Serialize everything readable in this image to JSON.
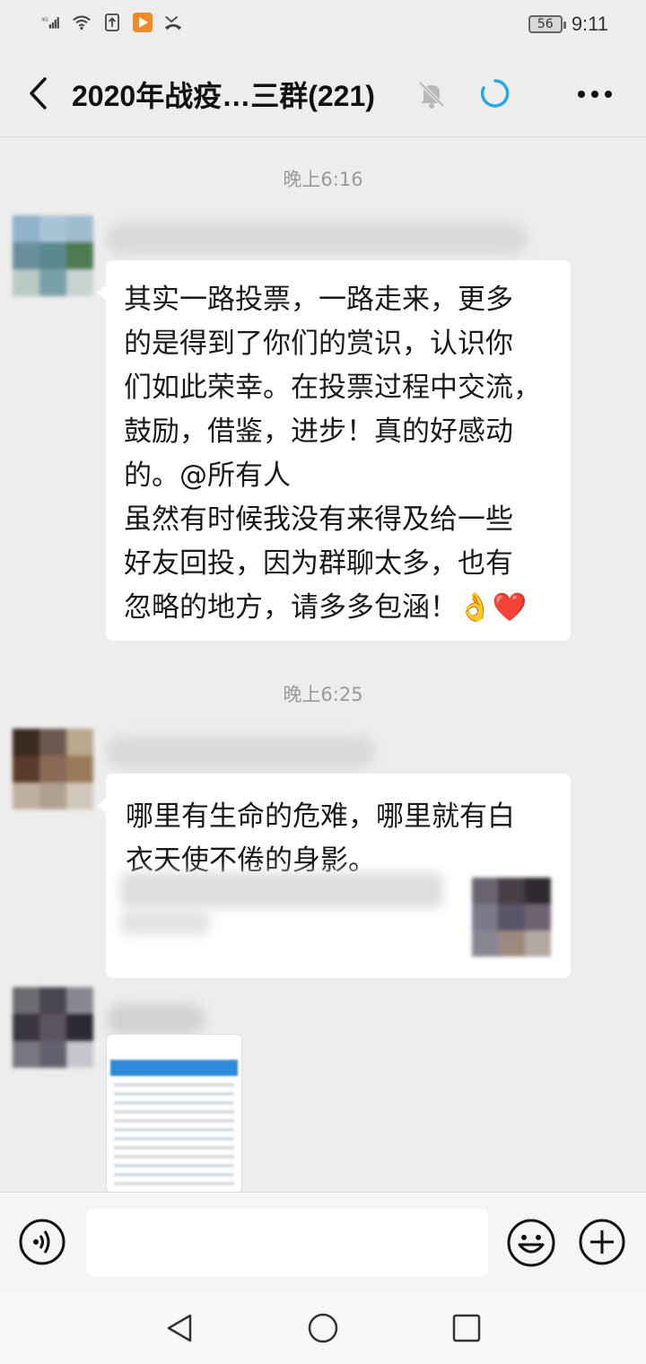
{
  "status_bar": {
    "signal_label": "4G",
    "battery": "56",
    "time": "9:11"
  },
  "header": {
    "title": "2020年战疫…三群(221)"
  },
  "messages": [
    {
      "timestamp": "晚上6:16",
      "text": "其实一路投票，一路走来，更多\n的是得到了你们的赏识，认识你\n们如此荣幸。在投票过程中交流，\n鼓励，借鉴，进步！真的好感动\n的。@所有人\n虽然有时候我没有来得及给一些\n好友回投，因为群聊太多，也有\n忽略的地方，请多多包涵！",
      "emojis": [
        "👌",
        "❤️"
      ]
    },
    {
      "timestamp": "晚上6:25",
      "text": "哪里有生命的危难，哪里就有白\n衣天使不倦的身影。"
    }
  ],
  "input": {
    "placeholder": ""
  },
  "colors": {
    "background": "#ededed",
    "bubble": "#ffffff",
    "loading_accent": "#2aa7e0"
  }
}
